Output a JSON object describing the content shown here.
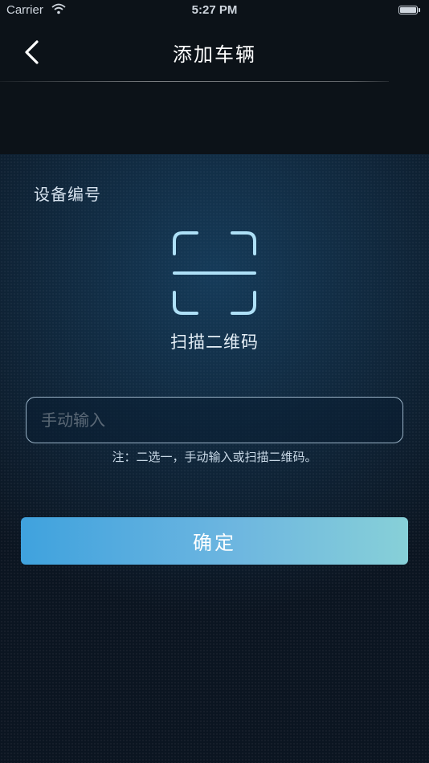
{
  "status_bar": {
    "carrier": "Carrier",
    "time": "5:27 PM",
    "wifi_icon": "wifi-icon",
    "battery_icon": "battery-icon"
  },
  "nav": {
    "back_icon": "chevron-left-icon",
    "title": "添加车辆"
  },
  "form": {
    "section_label": "设备编号",
    "scan_icon": "qr-scan-icon",
    "scan_label": "扫描二维码",
    "input_placeholder": "手动输入",
    "input_value": "",
    "hint": "注：二选一，手动输入或扫描二维码。",
    "confirm_label": "确定"
  },
  "colors": {
    "background": "#0b1119",
    "icon_accent": "#aee0f7",
    "button_gradient_start": "#3fa2de",
    "button_gradient_end": "#87d0d8"
  }
}
